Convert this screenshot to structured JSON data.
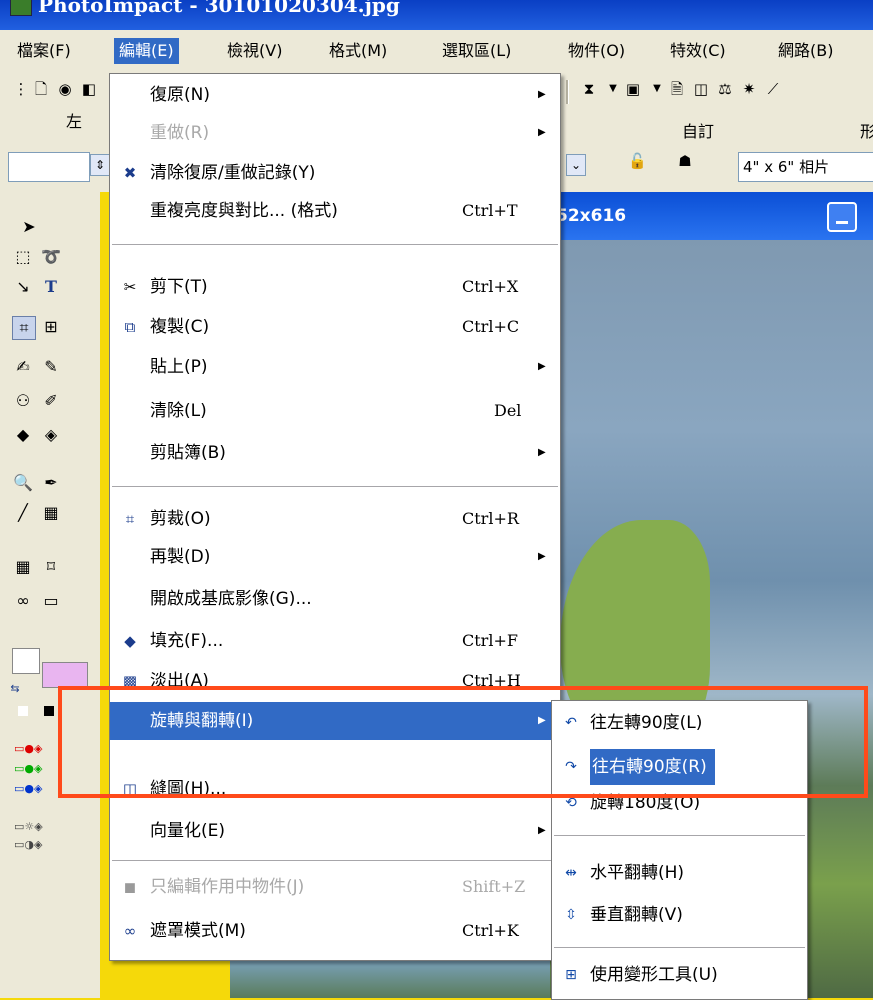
{
  "window": {
    "title": "PhotoImpact - 30101020304.jpg"
  },
  "menubar": {
    "items": [
      "檔案(F)",
      "編輯(E)",
      "檢視(V)",
      "格式(M)",
      "選取區(L)",
      "物件(O)",
      "特效(C)",
      "網路(B)"
    ]
  },
  "toolbar": {
    "label_left": "左",
    "label_custom": "自訂",
    "label_right": "形",
    "size_preset": "4\" x 6\" 相片"
  },
  "document": {
    "title_fragment": "52x616"
  },
  "edit_menu": {
    "items": [
      {
        "label": "復原(N)",
        "shortcut": "",
        "submenu": true,
        "disabled": false
      },
      {
        "label": "重做(R)",
        "shortcut": "",
        "submenu": true,
        "disabled": true
      },
      {
        "label": "清除復原/重做記錄(Y)",
        "shortcut": "",
        "submenu": false,
        "disabled": false
      },
      {
        "label": "重複亮度與對比... (格式)",
        "shortcut": "Ctrl+T",
        "submenu": false,
        "disabled": false
      },
      {
        "label": "剪下(T)",
        "shortcut": "Ctrl+X",
        "submenu": false,
        "disabled": false
      },
      {
        "label": "複製(C)",
        "shortcut": "Ctrl+C",
        "submenu": false,
        "disabled": false
      },
      {
        "label": "貼上(P)",
        "shortcut": "",
        "submenu": true,
        "disabled": false
      },
      {
        "label": "清除(L)",
        "shortcut": "Del",
        "submenu": false,
        "disabled": false
      },
      {
        "label": "剪貼簿(B)",
        "shortcut": "",
        "submenu": true,
        "disabled": false
      },
      {
        "label": "剪裁(O)",
        "shortcut": "Ctrl+R",
        "submenu": false,
        "disabled": false
      },
      {
        "label": "再製(D)",
        "shortcut": "",
        "submenu": true,
        "disabled": false
      },
      {
        "label": "開啟成基底影像(G)...",
        "shortcut": "",
        "submenu": false,
        "disabled": false
      },
      {
        "label": "填充(F)...",
        "shortcut": "Ctrl+F",
        "submenu": false,
        "disabled": false
      },
      {
        "label": "淡出(A)",
        "shortcut": "Ctrl+H",
        "submenu": false,
        "disabled": false
      },
      {
        "label": "旋轉與翻轉(I)",
        "shortcut": "",
        "submenu": true,
        "disabled": false,
        "highlighted": true
      },
      {
        "label": "縫圖(H)...",
        "shortcut": "",
        "submenu": false,
        "disabled": false
      },
      {
        "label": "向量化(E)",
        "shortcut": "",
        "submenu": true,
        "disabled": false
      },
      {
        "label": "只編輯作用中物件(J)",
        "shortcut": "Shift+Z",
        "submenu": false,
        "disabled": true
      },
      {
        "label": "遮罩模式(M)",
        "shortcut": "Ctrl+K",
        "submenu": false,
        "disabled": false
      }
    ]
  },
  "rotate_submenu": {
    "items": [
      {
        "label": "往左轉90度(L)",
        "highlighted": false
      },
      {
        "label": "往右轉90度(R)",
        "highlighted": true
      },
      {
        "label": "旋轉180度(O)",
        "highlighted": false
      },
      {
        "label": "水平翻轉(H)",
        "highlighted": false
      },
      {
        "label": "垂直翻轉(V)",
        "highlighted": false
      },
      {
        "label": "使用變形工具(U)",
        "highlighted": false
      }
    ]
  },
  "colors": {
    "highlight": "#316ac5",
    "annotation": "#ff4a1a",
    "background_accent": "#f5d90a"
  }
}
